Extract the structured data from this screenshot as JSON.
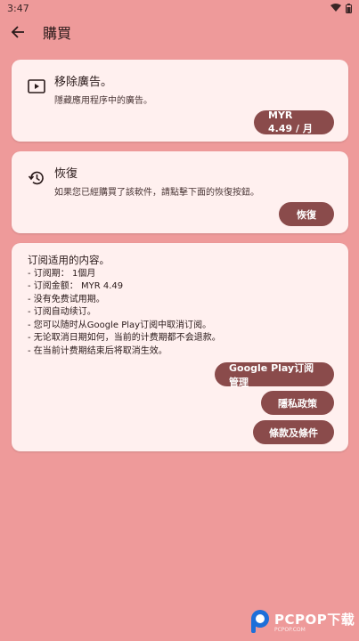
{
  "status_bar": {
    "time": "3:47"
  },
  "app_bar": {
    "title": "購買"
  },
  "remove_ads": {
    "title": "移除廣告。",
    "subtitle": "隱藏應用程序中的廣告。",
    "price_button": "MYR 4.49 / 月"
  },
  "restore": {
    "title": "恢復",
    "subtitle": "如果您已經購買了該軟件，請點擊下面的恢復按鈕。",
    "button": "恢復"
  },
  "subscription": {
    "heading": "订阅适用的内容。",
    "lines": [
      "- 订阅期： 1個月",
      "- 订阅金额： MYR 4.49",
      "- 没有免费试用期。",
      "- 订阅自动续订。",
      "- 您可以随时从Google Play订阅中取消订阅。",
      "- 无论取消日期如何，当前的计费期都不会退款。",
      "- 在当前计费期结束后将取消生效。"
    ],
    "buttons": {
      "manage": "Google Play订阅管理",
      "privacy": "隱私政策",
      "terms": "條款及條件"
    }
  },
  "watermark": {
    "text": "PCPOP下载",
    "sub": "PCPOP.COM"
  },
  "colors": {
    "background": "#EE9A9A",
    "card": "#FFF0EF",
    "button": "#8A4B4B"
  }
}
